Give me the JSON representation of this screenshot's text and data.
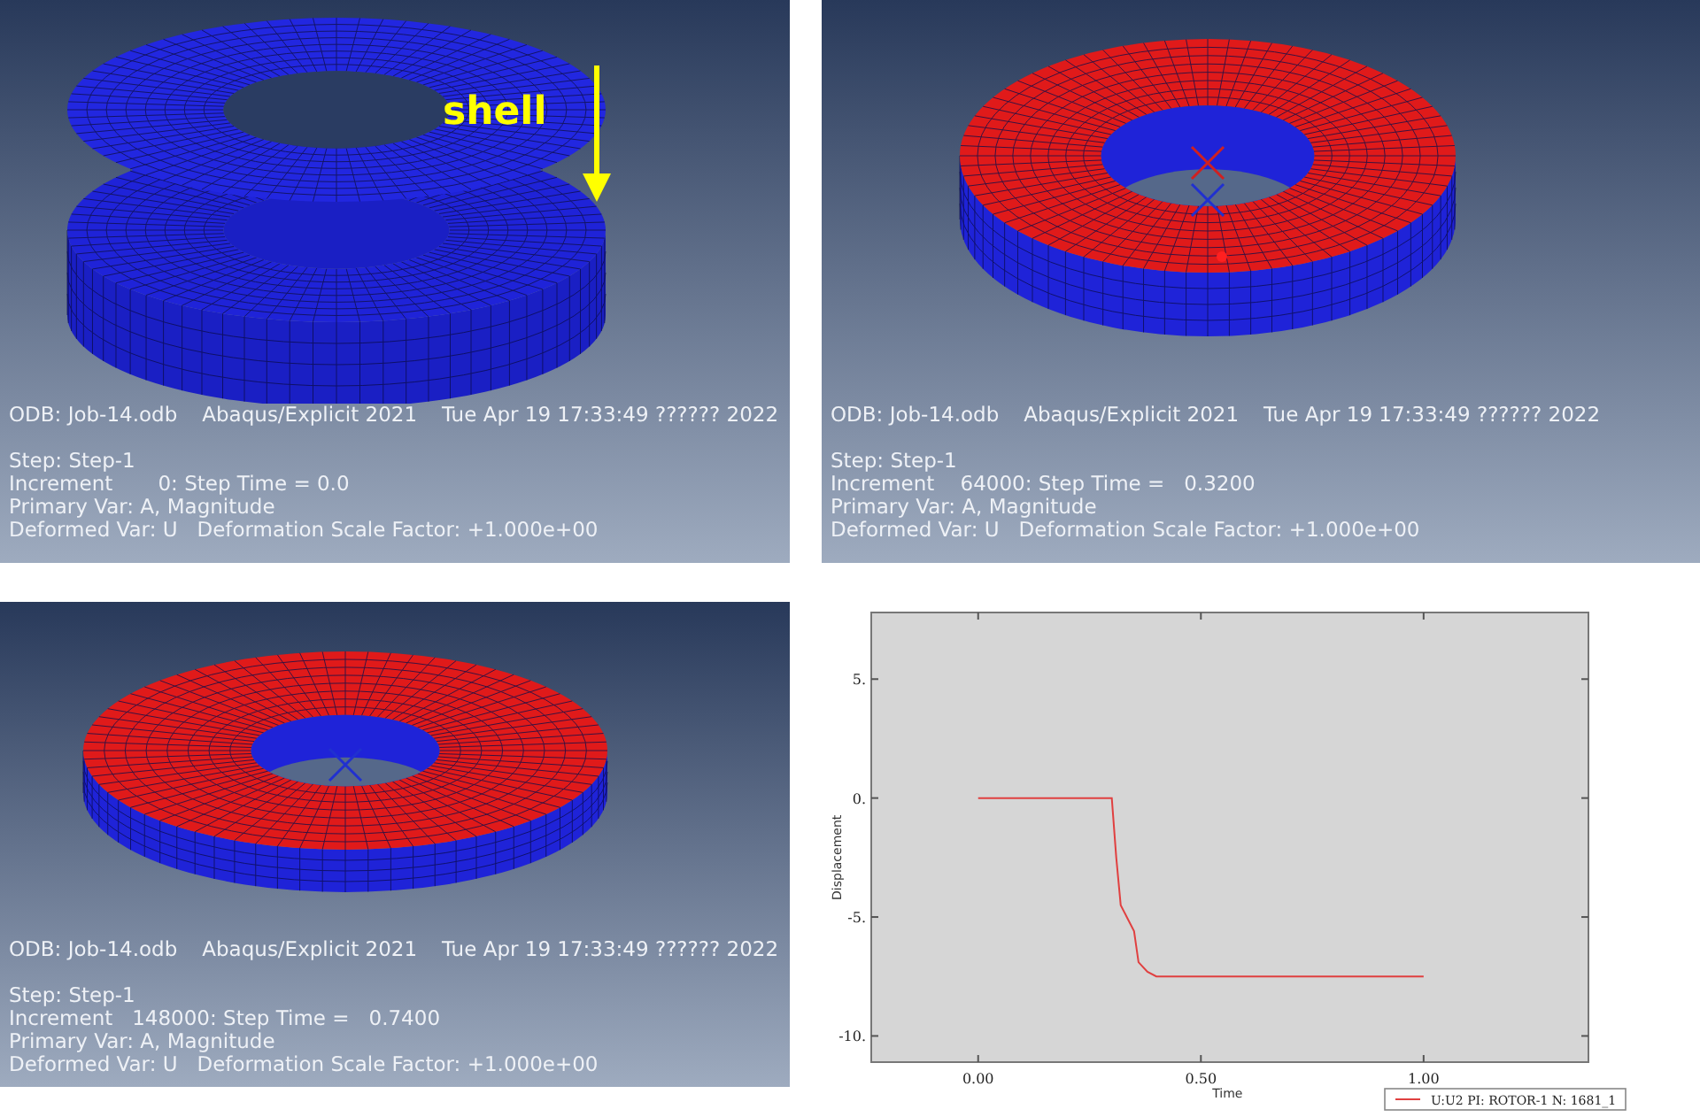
{
  "panels": [
    {
      "kind": "shell-above",
      "annotation": "shell",
      "odb": "ODB: Job-14.odb",
      "solver": "Abaqus/Explicit 2021",
      "date": "Tue Apr 19 17:33:49 ?????? 2022",
      "lines": [
        "Step: Step-1",
        "Increment       0: Step Time = 0.0",
        "Primary Var: A, Magnitude",
        "Deformed Var: U   Deformation Scale Factor: +1.000e+00"
      ]
    },
    {
      "kind": "pressed",
      "odb": "ODB: Job-14.odb",
      "solver": "Abaqus/Explicit 2021",
      "date": "Tue Apr 19 17:33:49 ?????? 2022",
      "lines": [
        "Step: Step-1",
        "Increment    64000: Step Time =   0.3200",
        "Primary Var: A, Magnitude",
        "Deformed Var: U   Deformation Scale Factor: +1.000e+00"
      ]
    },
    {
      "kind": "pressed-flat",
      "odb": "ODB: Job-14.odb",
      "solver": "Abaqus/Explicit 2021",
      "date": "Tue Apr 19 17:33:49 ?????? 2022",
      "lines": [
        "Step: Step-1",
        "Increment   148000: Step Time =   0.7400",
        "Primary Var: A, Magnitude",
        "Deformed Var: U   Deformation Scale Factor: +1.000e+00"
      ]
    },
    {
      "kind": "chart",
      "chart_data": {
        "type": "line",
        "xlabel": "Time",
        "ylabel": "Displacement",
        "x": [
          0,
          0.3,
          0.31,
          0.32,
          0.35,
          0.36,
          0.38,
          0.4,
          1.0
        ],
        "series": [
          {
            "name": "U:U2 PI: ROTOR-1 N: 1681_1",
            "color": "#e04040",
            "values": [
              0,
              0,
              -2.5,
              -4.5,
              -5.6,
              -6.9,
              -7.3,
              -7.5,
              -7.5
            ]
          }
        ],
        "xlim": [
          -0.24,
          1.37
        ],
        "ylim": [
          -11.1,
          7.8
        ],
        "xticks": [
          {
            "value": 0,
            "label": "0.00"
          },
          {
            "value": 0.5,
            "label": "0.50"
          },
          {
            "value": 1,
            "label": "1.00"
          }
        ],
        "yticks": [
          {
            "value": 5,
            "label": "5."
          },
          {
            "value": 0,
            "label": "0."
          },
          {
            "value": -5,
            "label": "-5."
          },
          {
            "value": -10,
            "label": "-10."
          }
        ]
      }
    }
  ]
}
